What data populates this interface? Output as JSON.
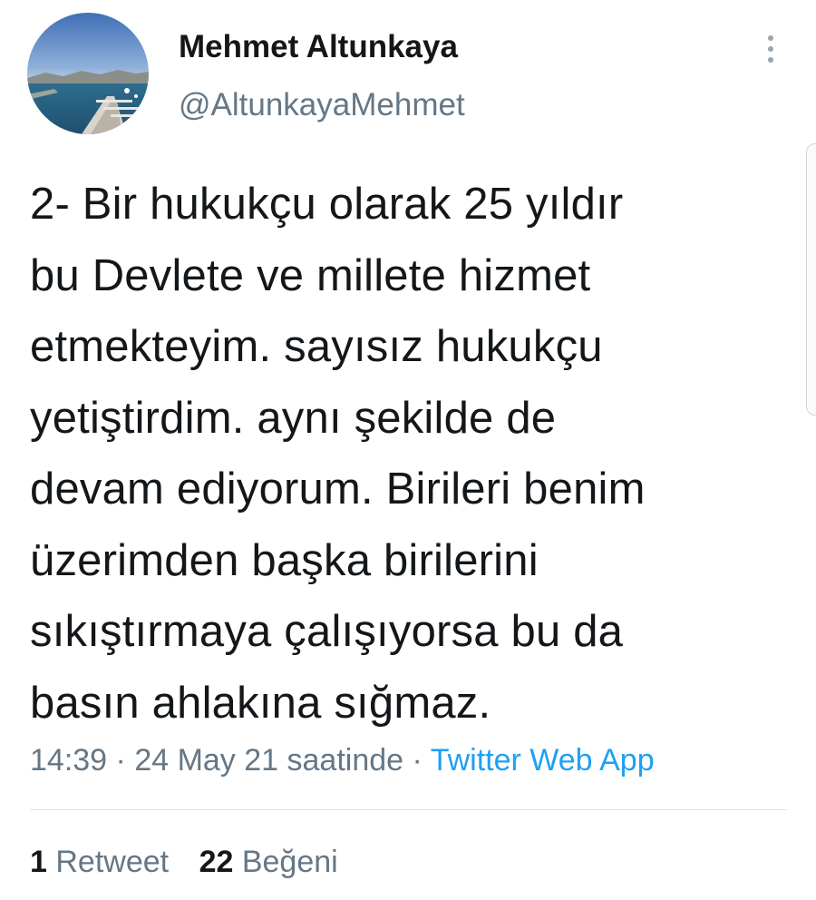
{
  "author": {
    "display_name": "Mehmet Altunkaya",
    "handle": "@AltunkayaMehmet",
    "avatar_icon": "harbor-photo-avatar"
  },
  "more_icon": "vertical-ellipsis-icon",
  "tweet": {
    "lines": [
      "2- Bir hukukçu olarak 25 yıldır",
      "bu Devlete ve millete hizmet",
      "etmekteyim. sayısız hukukçu",
      "yetiştirdim. aynı şekilde de",
      "devam ediyorum. Birileri benim",
      "üzerimden başka birilerini",
      "sıkıştırmaya çalışıyorsa bu da",
      "basın ahlakına sığmaz."
    ]
  },
  "meta": {
    "time": "14:39",
    "separator": " · ",
    "date": "24 May 21 saatinde",
    "source": "Twitter Web App"
  },
  "stats": {
    "retweets_count": "1",
    "retweets_label": "Retweet",
    "likes_count": "22",
    "likes_label": "Beğeni"
  },
  "colors": {
    "text": "#14171a",
    "secondary": "#657786",
    "link": "#1da1f2"
  }
}
